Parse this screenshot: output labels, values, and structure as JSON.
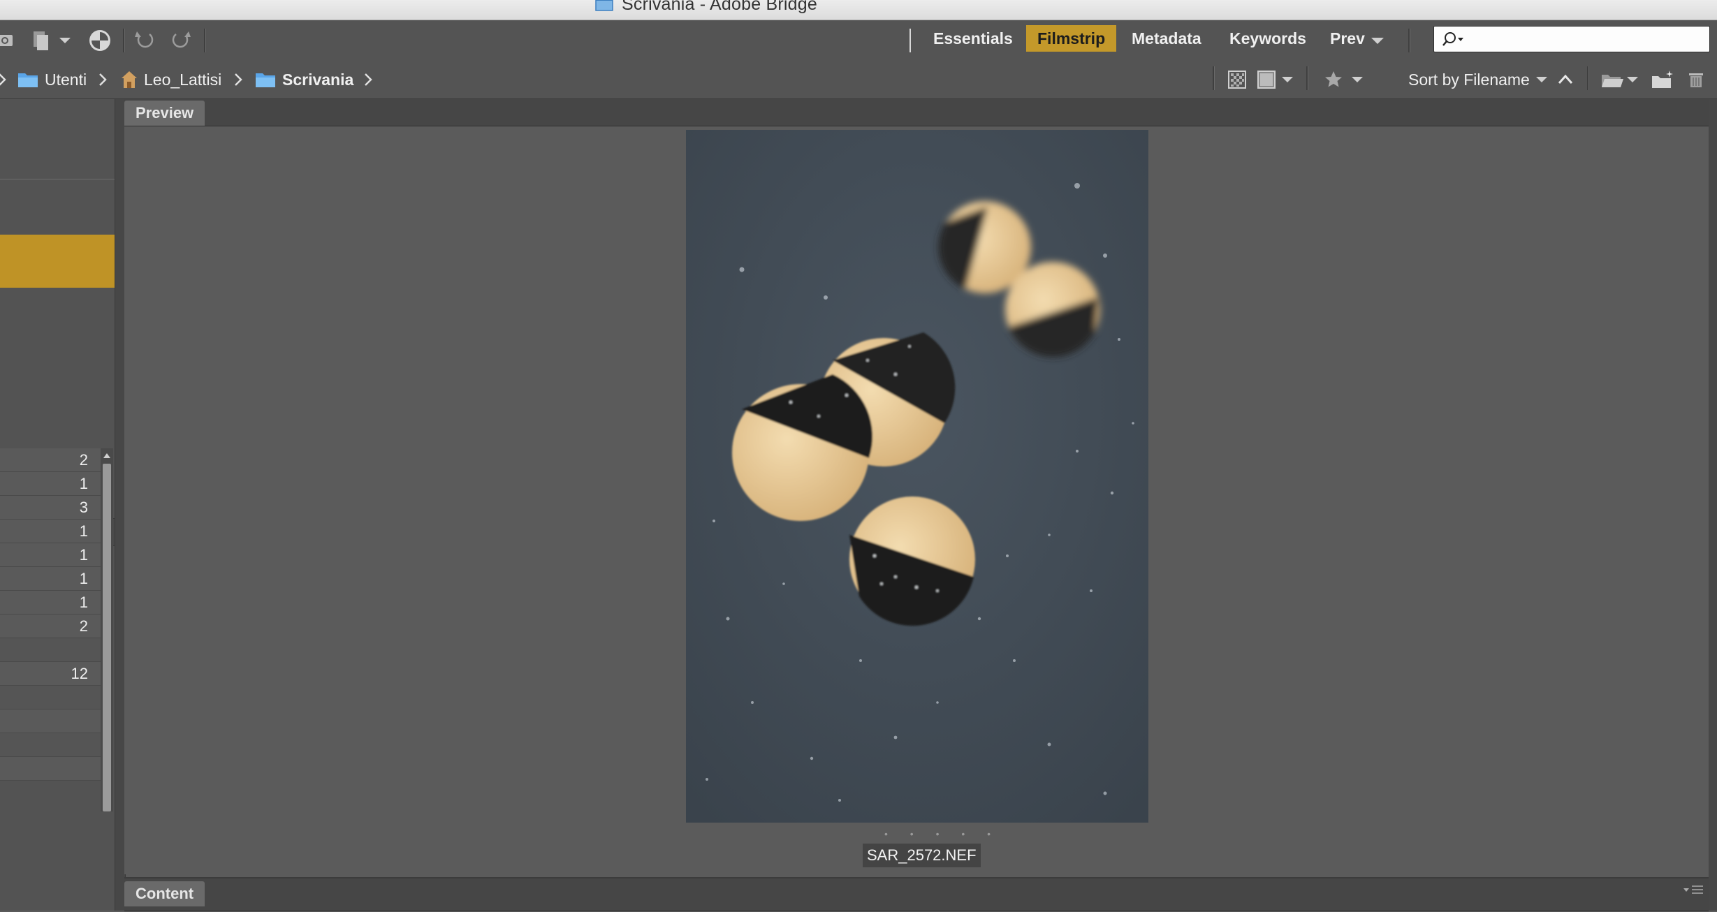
{
  "window": {
    "title": "Scrivania - Adobe Bridge"
  },
  "toolbar": {
    "icons": [
      "camera-icon",
      "copy-icon",
      "boomerang-icon",
      "rotate-left-icon",
      "rotate-right-icon"
    ],
    "workspaces": [
      {
        "label": "Essentials",
        "active": false
      },
      {
        "label": "Filmstrip",
        "active": true
      },
      {
        "label": "Metadata",
        "active": false
      },
      {
        "label": "Keywords",
        "active": false
      },
      {
        "label": "Prev",
        "active": false
      }
    ],
    "search": {
      "value": "",
      "placeholder": ""
    }
  },
  "pathbar": {
    "crumbs": [
      {
        "label": "Utenti",
        "icon": "folder-icon"
      },
      {
        "label": "Leo_Lattisi",
        "icon": "home-icon"
      },
      {
        "label": "Scrivania",
        "icon": "folder-icon"
      }
    ],
    "sort_label": "Sort by Filename"
  },
  "left_panel": {
    "counts": [
      "2",
      "1",
      "3",
      "1",
      "1",
      "1",
      "1",
      "2",
      "",
      "12",
      "",
      "",
      "",
      ""
    ]
  },
  "preview": {
    "tab_label": "Preview",
    "filename": "SAR_2572.NEF",
    "dots": "• • • • •"
  },
  "content": {
    "tab_label": "Content"
  },
  "colors": {
    "accent": "#c4992a",
    "panel_bg": "#5b5b5b",
    "toolbar_bg": "#545454"
  }
}
